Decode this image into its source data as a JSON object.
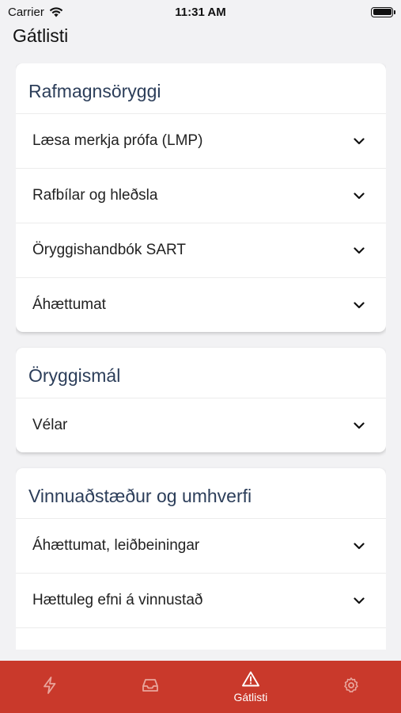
{
  "status_bar": {
    "carrier": "Carrier",
    "time": "11:31 AM"
  },
  "header": {
    "title": "Gátlisti"
  },
  "sections": [
    {
      "title": "Rafmagnsöryggi",
      "items": [
        {
          "label": "Læsa merkja prófa (LMP)"
        },
        {
          "label": "Rafbílar og hleðsla"
        },
        {
          "label": "Öryggishandbók SART"
        },
        {
          "label": "Áhættumat"
        }
      ]
    },
    {
      "title": "Öryggismál",
      "items": [
        {
          "label": "Vélar"
        }
      ]
    },
    {
      "title": "Vinnuaðstæður og umhverfi",
      "items": [
        {
          "label": "Áhættumat, leiðbeiningar"
        },
        {
          "label": "Hættuleg efni á vinnustað"
        },
        {
          "label": ""
        }
      ]
    }
  ],
  "tab_bar": {
    "background": "#c9392b",
    "tabs": [
      {
        "icon": "lightning-icon",
        "label": ""
      },
      {
        "icon": "inbox-icon",
        "label": ""
      },
      {
        "icon": "warning-triangle-icon",
        "label": "Gátlisti",
        "active": true
      },
      {
        "icon": "gear-icon",
        "label": ""
      }
    ]
  }
}
